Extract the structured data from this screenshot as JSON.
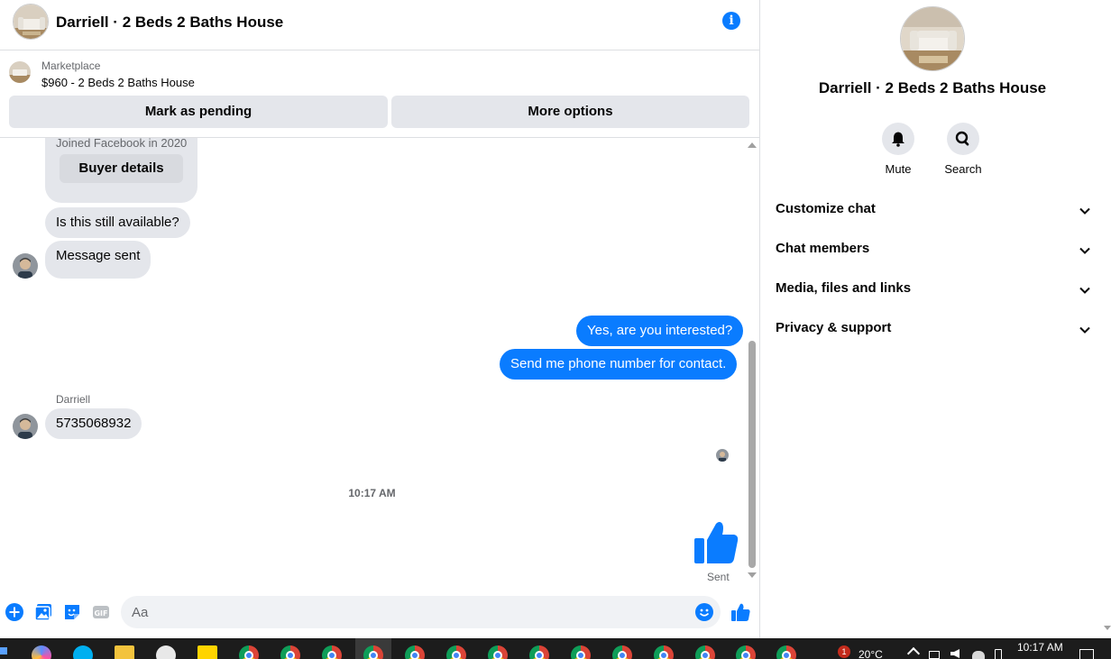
{
  "header": {
    "title": "Darriell · 2 Beds 2 Baths House",
    "info_icon": "info-icon"
  },
  "marketplace": {
    "label": "Marketplace",
    "listing": "$960 - 2 Beds 2 Baths House",
    "mark_pending": "Mark as pending",
    "more_options": "More options"
  },
  "messages": {
    "joined": "Joined Facebook in 2020",
    "buyer_details": "Buyer details",
    "incoming_1": "Is this still available?",
    "incoming_2": "Message sent",
    "outgoing_1": "Yes, are you interested?",
    "outgoing_2": "Send me phone number for contact.",
    "sender_name": "Darriell",
    "incoming_3": "5735068932",
    "timestamp": "10:17 AM",
    "sent_label": "Sent"
  },
  "composer": {
    "placeholder": "Aa"
  },
  "info_panel": {
    "name": "Darriell · 2 Beds 2 Baths House",
    "mute": "Mute",
    "search": "Search",
    "menu": [
      {
        "label": "Customize chat"
      },
      {
        "label": "Chat members"
      },
      {
        "label": "Media, files and links"
      },
      {
        "label": "Privacy & support"
      }
    ]
  },
  "taskbar": {
    "temperature": "20°C",
    "clock": "10:17 AM",
    "notification_count": "1"
  },
  "colors": {
    "accent": "#0a7cff",
    "bubble_gray": "#e4e6eb",
    "text_secondary": "#65676b"
  }
}
